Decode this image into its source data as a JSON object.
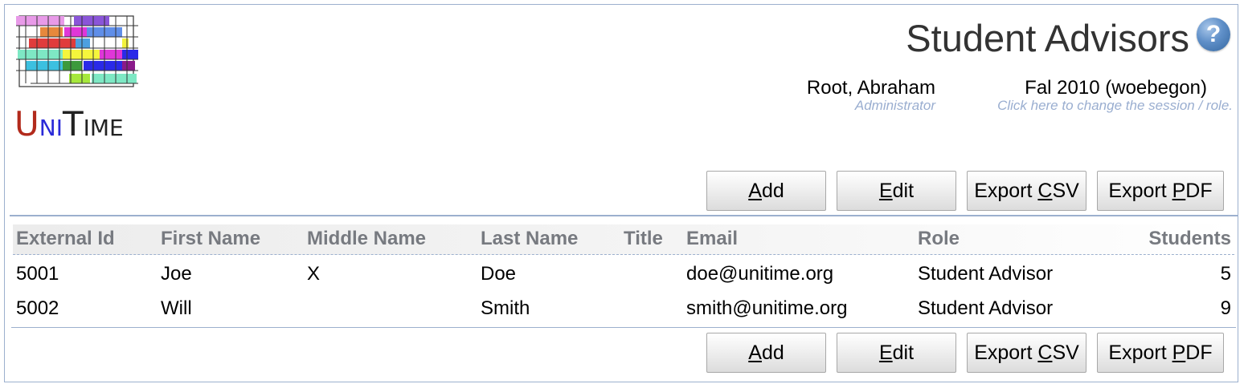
{
  "app": {
    "logo_text_parts": [
      "U",
      "NI",
      "T",
      "IME"
    ],
    "page_title": "Student Advisors",
    "help_icon": "?",
    "user": {
      "name": "Root, Abraham",
      "role": "Administrator"
    },
    "session": {
      "name": "Fal 2010 (woebegon)",
      "hint": "Click here to change the session / role."
    }
  },
  "toolbar": {
    "add": {
      "ul": "A",
      "rest": "dd"
    },
    "edit": {
      "ul": "E",
      "rest": "dit"
    },
    "export_csv": {
      "pre": "Export ",
      "ul": "C",
      "rest": "SV"
    },
    "export_pdf": {
      "pre": "Export ",
      "ul": "P",
      "rest": "DF"
    }
  },
  "table": {
    "columns": [
      "External Id",
      "First Name",
      "Middle Name",
      "Last Name",
      "Title",
      "Email",
      "Role",
      "Students"
    ],
    "rows": [
      [
        "5001",
        "Joe",
        "X",
        "Doe",
        "",
        "doe@unitime.org",
        "Student Advisor",
        "5"
      ],
      [
        "5002",
        "Will",
        "",
        "Smith",
        "",
        "smith@unitime.org",
        "Student Advisor",
        "9"
      ]
    ]
  },
  "colors": {
    "accent_border": "#9cb0ce",
    "header_text": "#777a80",
    "hint_text": "#9aaed0"
  },
  "icons": {
    "help": "help-icon",
    "logo": "unitime-logo"
  }
}
